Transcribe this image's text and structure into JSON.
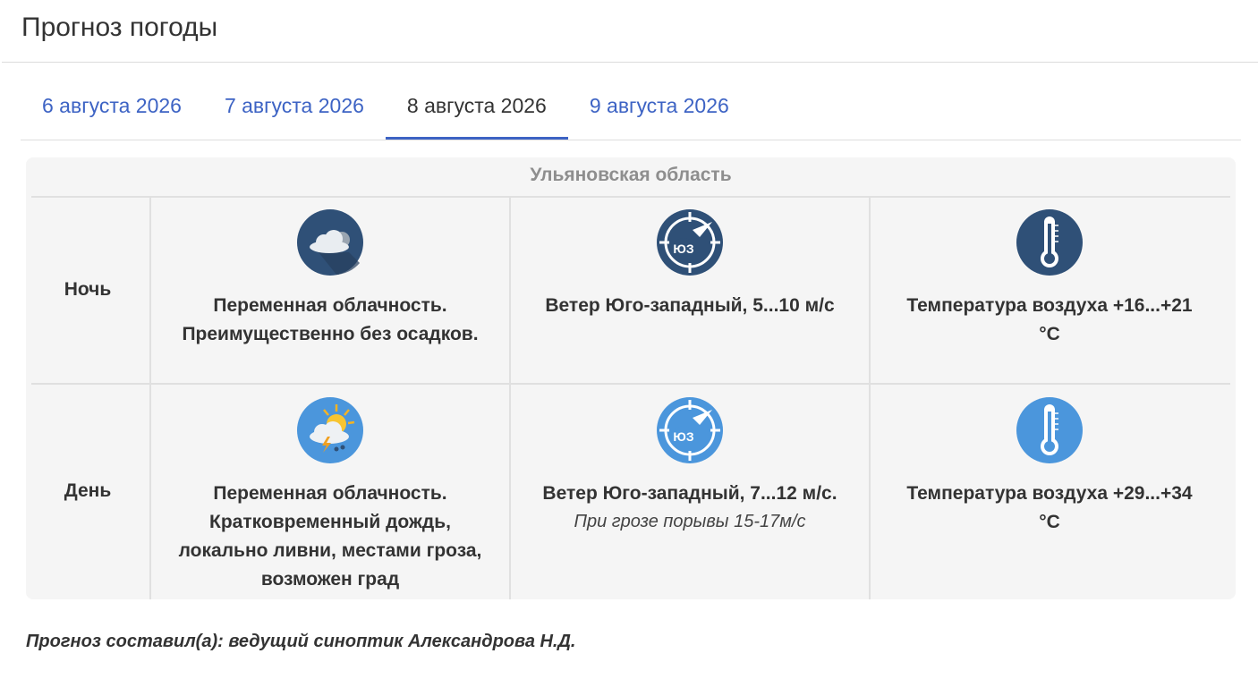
{
  "page": {
    "title": "Прогноз погоды"
  },
  "tabs": [
    {
      "label": "6 августа 2026",
      "active": false
    },
    {
      "label": "7 августа 2026",
      "active": false
    },
    {
      "label": "8 августа 2026",
      "active": true
    },
    {
      "label": "9 августа 2026",
      "active": false
    }
  ],
  "forecast": {
    "region": "Ульяновская область",
    "rows": [
      {
        "label": "Ночь",
        "weather": {
          "icon": "cloud-icon",
          "text": "Переменная облачность. Преимущественно без осадков."
        },
        "wind": {
          "icon": "wind-direction-icon",
          "direction_abbr": "ЮЗ",
          "text": "Ветер Юго-западный, 5...10 м/с",
          "note": ""
        },
        "temperature": {
          "icon": "thermometer-icon",
          "text": "Температура воздуха +16...+21 °С"
        }
      },
      {
        "label": "День",
        "weather": {
          "icon": "sun-cloud-thunder-rain-icon",
          "text": "Переменная облачность. Кратковременный дождь, локально ливни, местами гроза, возможен град"
        },
        "wind": {
          "icon": "wind-direction-icon",
          "direction_abbr": "ЮЗ",
          "text": "Ветер Юго-западный, 7...12 м/с.",
          "note": "При грозе порывы 15-17м/с"
        },
        "temperature": {
          "icon": "thermometer-icon",
          "text": "Температура воздуха +29...+34 °С"
        }
      }
    ]
  },
  "footer": {
    "author": "Прогноз составил(а): ведущий синоптик Александрова Н.Д."
  },
  "colors": {
    "accent": "#3d63c4",
    "night_icon": "#2f5077",
    "day_icon": "#4b96dc",
    "panel_bg": "#f5f5f5"
  }
}
